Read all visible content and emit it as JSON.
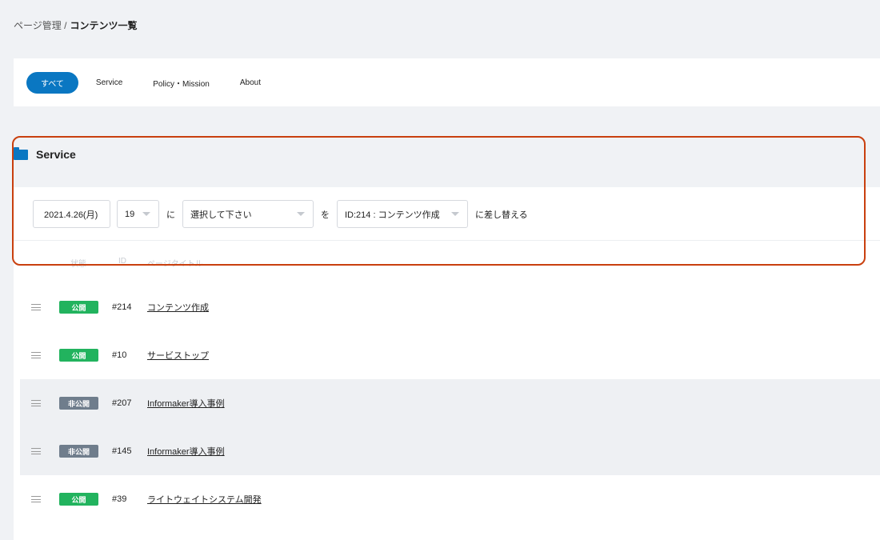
{
  "breadcrumb": {
    "parent": "ページ管理 /",
    "current": "コンテンツ一覧"
  },
  "tabs": [
    {
      "label": "すべて",
      "active": true
    },
    {
      "label": "Service",
      "active": false
    },
    {
      "label": "Policy・Mission",
      "active": false
    },
    {
      "label": "About",
      "active": false
    }
  ],
  "section": {
    "title": "Service",
    "icon": "folder-icon"
  },
  "schedule": {
    "date": "2021.4.26(月)",
    "hour": "19",
    "particle_ni": "に",
    "select_placeholder": "選択して下さい",
    "particle_wo": "を",
    "target": "ID:214 : コンテンツ作成",
    "suffix": "に差し替える"
  },
  "columns": {
    "status": "状態",
    "id": "ID",
    "title": "ページタイトル"
  },
  "rows": [
    {
      "status": "公開",
      "id": "#214",
      "title": "コンテンツ作成"
    },
    {
      "status": "公開",
      "id": "#10",
      "title": "サービストップ"
    },
    {
      "status": "非公開",
      "id": "#207",
      "title": "Informaker導入事例"
    },
    {
      "status": "非公開",
      "id": "#145",
      "title": "Informaker導入事例"
    },
    {
      "status": "公開",
      "id": "#39",
      "title": "ライトウェイトシステム開発"
    }
  ],
  "colors": {
    "accent": "#0a77c2",
    "public": "#22b35e",
    "private": "#6f7d8c",
    "highlight": "#c9400f"
  }
}
